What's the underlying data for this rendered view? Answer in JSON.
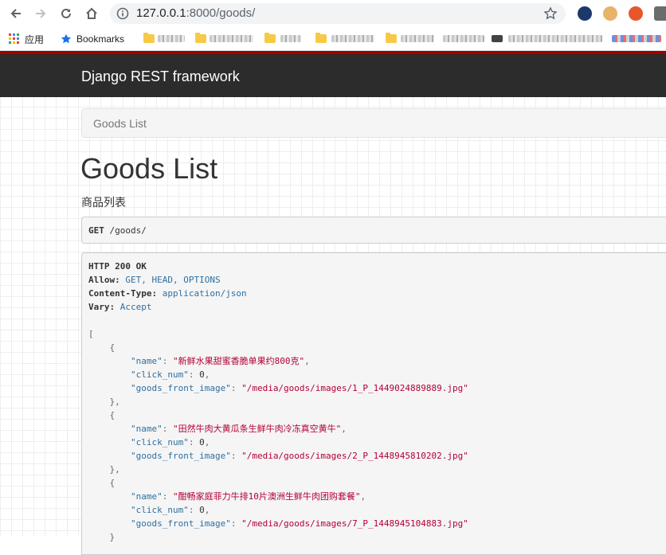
{
  "browser": {
    "url_host": "127.0.0.1",
    "url_rest": ":8000/goods/",
    "bookmarks": {
      "apps_label": "应用",
      "bookmarks_label": "Bookmarks"
    }
  },
  "drf": {
    "brand": "Django REST framework",
    "breadcrumb": "Goods List",
    "title": "Goods List",
    "description": "商品列表",
    "request": {
      "method": "GET",
      "path": "/goods/"
    },
    "response_headers": {
      "status": "HTTP 200 OK",
      "allow_label": "Allow:",
      "allow_value": "GET, HEAD, OPTIONS",
      "content_type_label": "Content-Type:",
      "content_type_value": "application/json",
      "vary_label": "Vary:",
      "vary_value": "Accept"
    },
    "json_keys": {
      "name": "\"name\"",
      "click_num": "\"click_num\"",
      "goods_front_image": "\"goods_front_image\""
    },
    "items": [
      {
        "name": "\"新鲜水果甜蜜香脆单果约800克\"",
        "click_num": "0",
        "goods_front_image": "\"/media/goods/images/1_P_1449024889889.jpg\""
      },
      {
        "name": "\"田然牛肉大黄瓜条生鲜牛肉冷冻真空黄牛\"",
        "click_num": "0",
        "goods_front_image": "\"/media/goods/images/2_P_1448945810202.jpg\""
      },
      {
        "name": "\"酣畅家庭菲力牛排10片澳洲生鲜牛肉团购套餐\"",
        "click_num": "0",
        "goods_front_image": "\"/media/goods/images/7_P_1448945104883.jpg\""
      }
    ]
  }
}
